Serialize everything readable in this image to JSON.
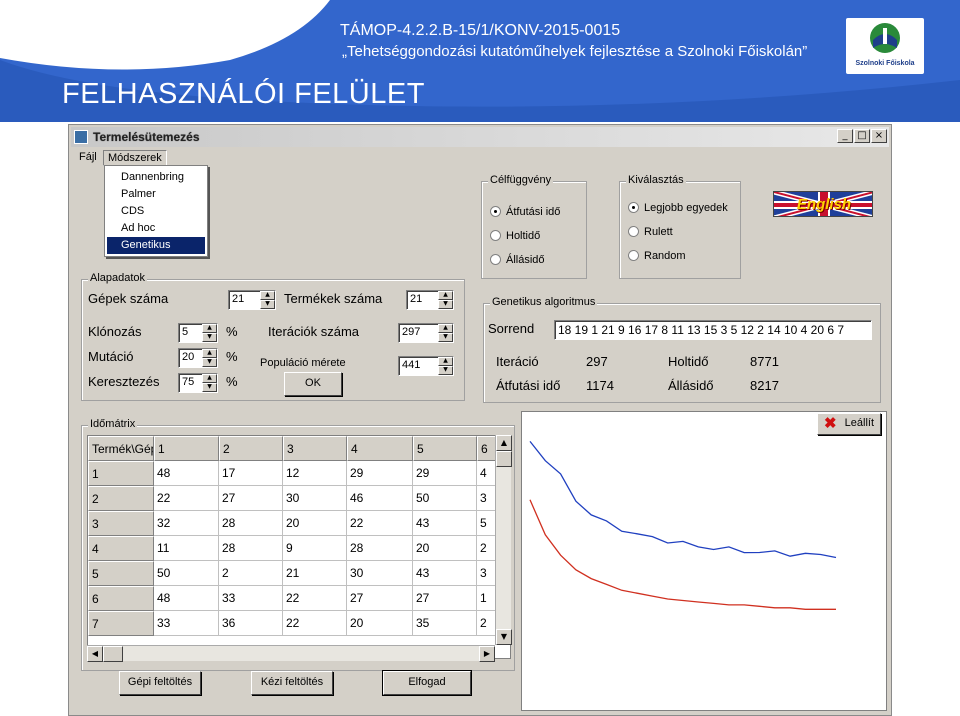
{
  "slide": {
    "project_code": "TÁMOP-4.2.2.B-15/1/KONV-2015-0015",
    "project_subtitle": "„Tehetséggondozási kutatóműhelyek fejlesztése a Szolnoki Főiskolán”",
    "title": "FELHASZNÁLÓI FELÜLET",
    "logo_text": "Szolnoki Főiskola",
    "header_color": "#2a5bbd"
  },
  "window": {
    "title": "Termelésütemezés",
    "controls": [
      "_",
      "□",
      "×"
    ],
    "menu": [
      "Fájl",
      "Módszerek"
    ],
    "methods_menu": [
      "Dannenbring",
      "Palmer",
      "CDS",
      "Ad hoc",
      "Genetikus"
    ],
    "methods_selected": "Genetikus"
  },
  "objective": {
    "label": "Célfüggvény",
    "options": [
      "Átfutási idő",
      "Holtidő",
      "Állásidő"
    ],
    "selected": "Átfutási idő"
  },
  "selection": {
    "label": "Kiválasztás",
    "options": [
      "Legjobb egyedek",
      "Rulett",
      "Random"
    ],
    "selected": "Legjobb egyedek"
  },
  "language_button": "English",
  "base_data": {
    "label": "Alapadatok",
    "machines_label": "Gépek száma",
    "machines": "21",
    "products_label": "Termékek száma",
    "products": "21",
    "cloning_label": "Klónozás",
    "cloning": "5",
    "mutation_label": "Mutáció",
    "mutation": "20",
    "crossover_label": "Keresztezés",
    "crossover": "75",
    "percent": "%",
    "iterations_label": "Iterációk száma",
    "iterations": "297",
    "population_label": "Populáció mérete",
    "population": "441",
    "ok_button": "OK"
  },
  "genetic": {
    "label": "Genetikus algoritmus",
    "order_label": "Sorrend",
    "order": "18 19 1 21 9 16 17 8 11 13 15 3 5 12 2 14 10 4 20 6 7",
    "iteration_label": "Iteráció",
    "iteration": "297",
    "idle_label": "Holtidő",
    "idle": "8771",
    "makespan_label": "Átfutási idő",
    "makespan": "1174",
    "downtime_label": "Állásidő",
    "downtime": "8217"
  },
  "time_matrix": {
    "label": "Időmátrix",
    "corner": "Termék\\Gép",
    "columns": [
      "1",
      "2",
      "3",
      "4",
      "5",
      "6"
    ],
    "rows": [
      {
        "id": "1",
        "cells": [
          "48",
          "17",
          "12",
          "29",
          "29",
          "4"
        ]
      },
      {
        "id": "2",
        "cells": [
          "22",
          "27",
          "30",
          "46",
          "50",
          "3"
        ]
      },
      {
        "id": "3",
        "cells": [
          "32",
          "28",
          "20",
          "22",
          "43",
          "5"
        ]
      },
      {
        "id": "4",
        "cells": [
          "11",
          "28",
          "9",
          "28",
          "20",
          "2"
        ]
      },
      {
        "id": "5",
        "cells": [
          "50",
          "2",
          "21",
          "30",
          "43",
          "3"
        ]
      },
      {
        "id": "6",
        "cells": [
          "48",
          "33",
          "22",
          "27",
          "27",
          "1"
        ]
      },
      {
        "id": "7",
        "cells": [
          "33",
          "36",
          "22",
          "20",
          "35",
          "2"
        ]
      }
    ]
  },
  "buttons": {
    "machine_fill": "Gépi feltöltés",
    "manual_fill": "Kézi feltöltés",
    "accept": "Elfogad",
    "stop": "Leállít"
  },
  "progress_chart": {
    "series": [
      {
        "color": "#2040c0",
        "values": [
          0.08,
          0.14,
          0.2,
          0.28,
          0.33,
          0.36,
          0.38,
          0.4,
          0.41,
          0.42,
          0.43,
          0.44,
          0.445,
          0.45,
          0.455,
          0.46,
          0.462,
          0.465,
          0.468,
          0.47,
          0.47
        ]
      },
      {
        "color": "#d03020",
        "values": [
          0.28,
          0.4,
          0.47,
          0.52,
          0.55,
          0.57,
          0.59,
          0.6,
          0.61,
          0.62,
          0.625,
          0.63,
          0.635,
          0.64,
          0.64,
          0.645,
          0.65,
          0.65,
          0.655,
          0.655,
          0.655
        ]
      }
    ]
  }
}
